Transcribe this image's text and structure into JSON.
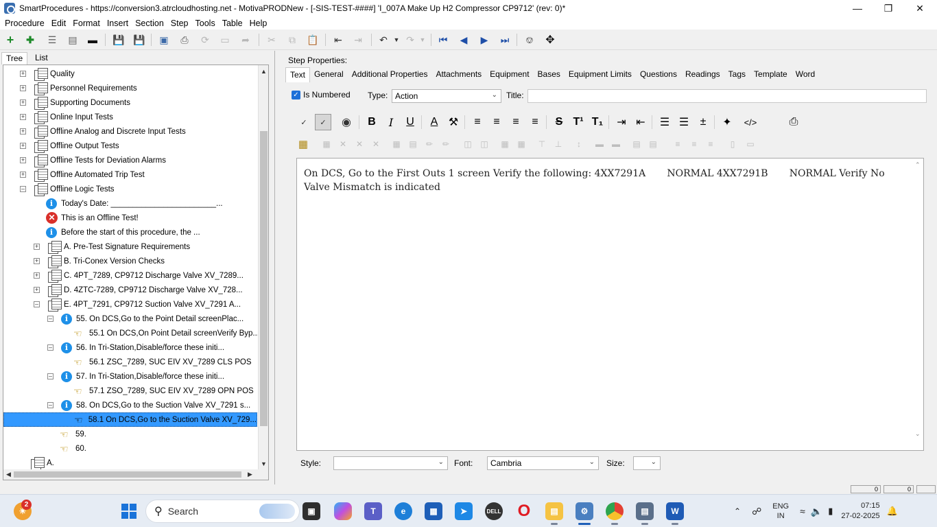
{
  "window": {
    "title": "SmartProcedures - https://conversion3.atrcloudhosting.net - MotivaPRODNew - [-SIS-TEST-####] 'I_007A Make Up H2 Compressor CP9712' (rev: 0)*"
  },
  "menu": [
    "Procedure",
    "Edit",
    "Format",
    "Insert",
    "Section",
    "Step",
    "Tools",
    "Table",
    "Help"
  ],
  "left_tabs": [
    "Tree",
    "List"
  ],
  "tree": [
    {
      "text": "Quality",
      "icon": "doc-icon"
    },
    {
      "text": "Personnel Requirements",
      "icon": "doc-icon"
    },
    {
      "text": "Supporting Documents",
      "icon": "doc-icon"
    },
    {
      "text": "Online Input Tests",
      "icon": "doc-icon"
    },
    {
      "text": "Offline Analog and Discrete Input Tests",
      "icon": "doc-icon"
    },
    {
      "text": "Offline Output Tests",
      "icon": "doc-icon"
    },
    {
      "text": "Offline Tests for Deviation Alarms",
      "icon": "doc-icon"
    },
    {
      "text": "Offline Automated Trip Test",
      "icon": "doc-icon"
    },
    {
      "text": "Offline Logic Tests",
      "icon": "doc-icon"
    },
    {
      "text": "Today's Date: ________________________...",
      "icon": "info-icon"
    },
    {
      "text": "This is an Offline Test!",
      "icon": "error-icon"
    },
    {
      "text": "Before the start of this procedure, the ...",
      "icon": "info-icon"
    },
    {
      "text": "A. Pre-Test Signature Requirements",
      "icon": "doc-icon"
    },
    {
      "text": "B. Tri-Conex Version Checks",
      "icon": "doc-icon"
    },
    {
      "text": "C. 4PT_7289, CP9712 Discharge Valve XV_7289...",
      "icon": "doc-icon"
    },
    {
      "text": "D. 4ZTC-7289, CP9712 Discharge Valve XV_728...",
      "icon": "doc-icon"
    },
    {
      "text": "E. 4PT_7291, CP9712 Suction Valve XV_7291 A...",
      "icon": "doc-icon"
    },
    {
      "text": "55. On DCS,Go to the Point Detail screenPlac...",
      "icon": "info-icon"
    },
    {
      "text": "55.1 On DCS,On Point Detail screenVerify Byp...",
      "icon": "hand-pointer-icon"
    },
    {
      "text": "56. In Tri-Station,Disable/force these initi...",
      "icon": "info-icon"
    },
    {
      "text": "56.1 ZSC_7289, SUC EIV XV_7289 CLS POS",
      "icon": "hand-pointer-icon"
    },
    {
      "text": "57. In Tri-Station,Disable/force these initi...",
      "icon": "info-icon"
    },
    {
      "text": "57.1 ZSO_7289, SUC EIV XV_7289 OPN POS",
      "icon": "hand-pointer-icon"
    },
    {
      "text": "58. On DCS,Go to the Suction Valve XV_7291 s...",
      "icon": "info-icon"
    },
    {
      "text": "58.1 On DCS,Go to the Suction Valve XV_729...",
      "icon": "hand-pointer-icon"
    },
    {
      "text": "59.",
      "icon": "hand-pointer-icon"
    },
    {
      "text": "60.",
      "icon": "hand-pointer-icon"
    },
    {
      "text": "A.",
      "icon": "doc-icon"
    }
  ],
  "step_props": {
    "heading": "Step Properties:",
    "tabs": [
      "Text",
      "General",
      "Additional Properties",
      "Attachments",
      "Equipment",
      "Bases",
      "Equipment Limits",
      "Questions",
      "Readings",
      "Tags",
      "Template",
      "Word"
    ],
    "is_numbered_label": "Is Numbered",
    "type_label": "Type:",
    "type_value": "Action",
    "title_label": "Title:",
    "title_value": "",
    "editor_text": "On DCS, Go to the First Outs 1 screen Verify the following: 4XX7291A       NORMAL 4XX7291B       NORMAL Verify No Valve Mismatch is indicated",
    "style_label": "Style:",
    "style_value": "",
    "font_label": "Font:",
    "font_value": "Cambria",
    "size_label": "Size:",
    "size_value": ""
  },
  "statusbar": [
    "0",
    "0"
  ],
  "taskbar": {
    "search_label": "Search",
    "notification_count": "2",
    "lang_top": "ENG",
    "lang_bottom": "IN",
    "time": "07:15",
    "date": "27-02-2025"
  }
}
